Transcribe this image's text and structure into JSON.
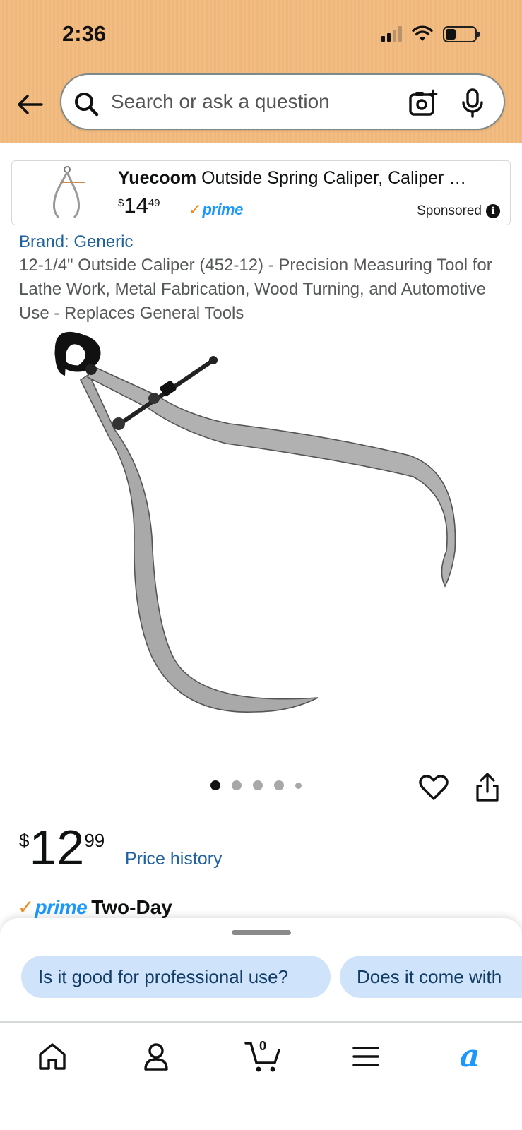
{
  "status_bar": {
    "time": "2:36"
  },
  "search": {
    "placeholder": "Search or ask a question"
  },
  "sponsored_ad": {
    "brand": "Yuecoom",
    "title_rest": " Outside Spring Caliper, Caliper …",
    "price_currency": "$",
    "price_whole": "14",
    "price_fraction": "49",
    "prime_check": "✓",
    "prime_word": "prime",
    "label": "Sponsored",
    "info_icon": "i"
  },
  "product": {
    "brand_link": "Brand: Generic",
    "title": "12-1/4\" Outside Caliper (452-12) - Precision Measuring Tool for Lathe Work, Metal Fabrication, Wood Turning, and Automotive Use - Replaces General Tools",
    "image_count": 5,
    "active_image": 1
  },
  "pricing": {
    "currency": "$",
    "whole": "12",
    "fraction": "99",
    "price_history_link": "Price history"
  },
  "delivery": {
    "prime_check": "✓",
    "prime_word": "prime",
    "speed": "Two-Day"
  },
  "suggestions": [
    "Is it good for professional use?",
    "Does it come with"
  ],
  "bottom_nav": {
    "cart_count": "0",
    "rufus_glyph": "a"
  },
  "icons": {
    "back": "arrow-left-icon",
    "search": "search-icon",
    "camera": "camera-sparkle-icon",
    "mic": "microphone-icon",
    "wishlist": "heart-icon",
    "share": "share-icon",
    "home": "home-icon",
    "account": "person-icon",
    "cart": "cart-icon",
    "menu": "hamburger-menu-icon",
    "rufus": "rufus-ai-icon"
  },
  "colors": {
    "header_bg": "#f2bd83",
    "link": "#2162a1",
    "prime_blue": "#1a98ff",
    "prime_check": "#f08a24",
    "chip_bg": "#cfe3fb"
  }
}
